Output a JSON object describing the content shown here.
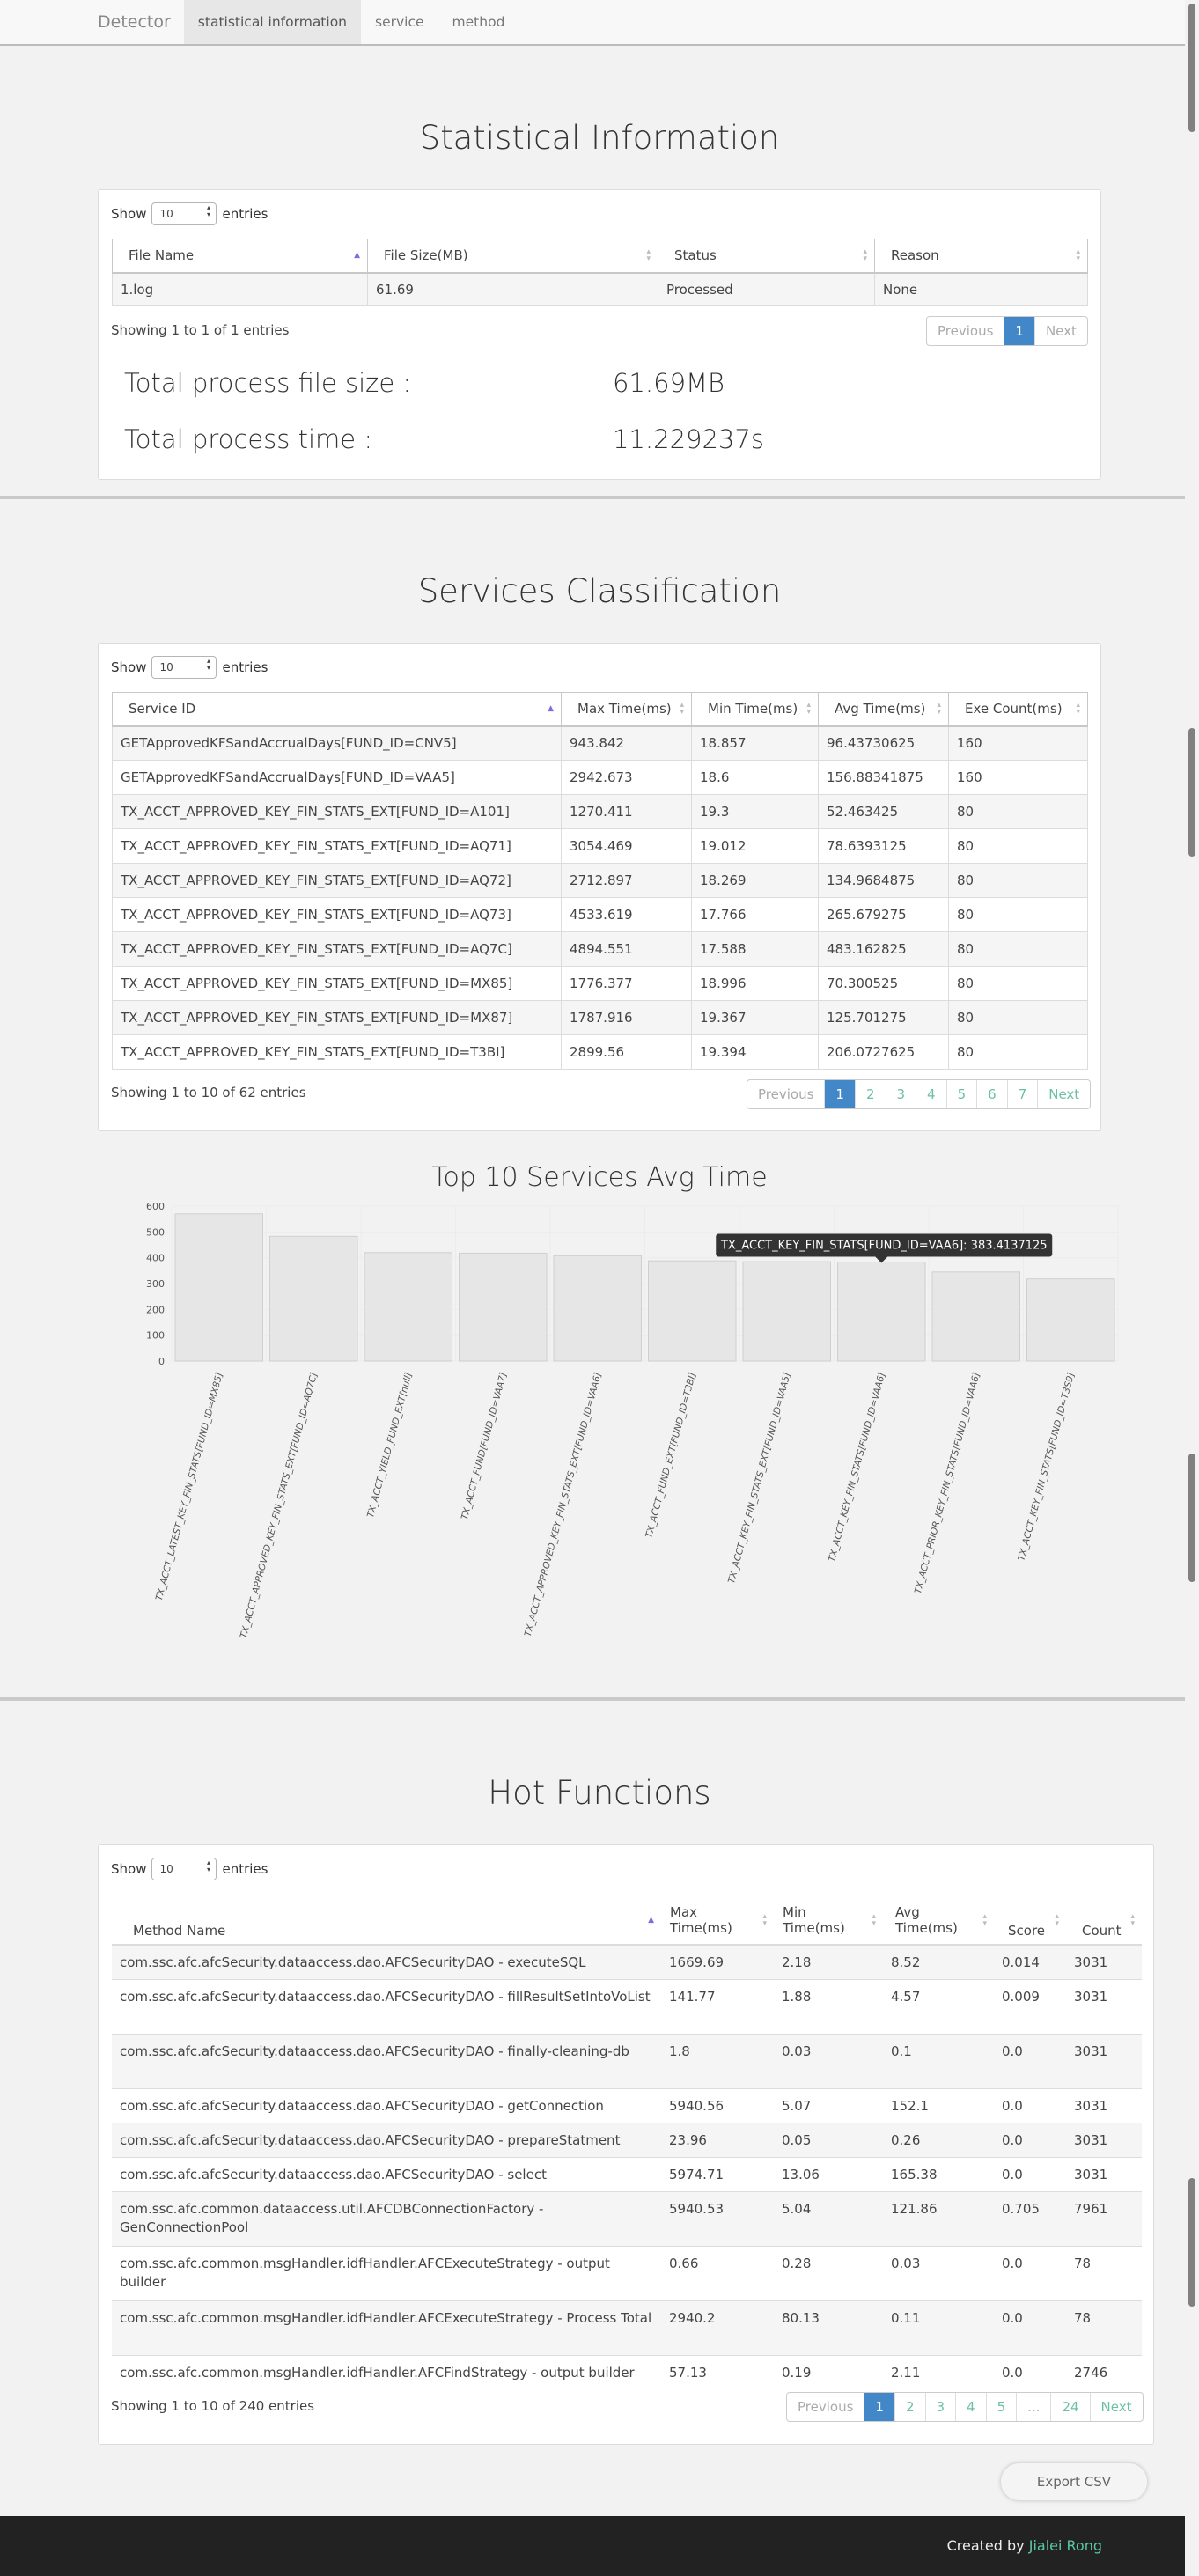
{
  "nav": {
    "brand": "Detector",
    "items": [
      "statistical information",
      "service",
      "method"
    ],
    "active_index": 0
  },
  "stats": {
    "title": "Statistical Information",
    "show": "Show",
    "entries_word": "entries",
    "page_length": "10",
    "columns": [
      "File Name",
      "File Size(MB)",
      "Status",
      "Reason"
    ],
    "rows": [
      [
        "1.log",
        "61.69",
        "Processed",
        "None"
      ]
    ],
    "info": "Showing 1 to 1 of 1 entries",
    "pager": [
      "Previous",
      "1",
      "Next"
    ],
    "total_size_label": "Total process file size :",
    "total_size_value": "61.69MB",
    "total_time_label": "Total process time :",
    "total_time_value": "11.229237s"
  },
  "services": {
    "title": "Services Classification",
    "show": "Show",
    "entries_word": "entries",
    "page_length": "10",
    "columns": [
      "Service ID",
      "Max Time(ms)",
      "Min Time(ms)",
      "Avg Time(ms)",
      "Exe Count(ms)"
    ],
    "rows": [
      [
        "GETApprovedKFSandAccrualDays[FUND_ID=CNV5]",
        "943.842",
        "18.857",
        "96.43730625",
        "160"
      ],
      [
        "GETApprovedKFSandAccrualDays[FUND_ID=VAA5]",
        "2942.673",
        "18.6",
        "156.88341875",
        "160"
      ],
      [
        "TX_ACCT_APPROVED_KEY_FIN_STATS_EXT[FUND_ID=A101]",
        "1270.411",
        "19.3",
        "52.463425",
        "80"
      ],
      [
        "TX_ACCT_APPROVED_KEY_FIN_STATS_EXT[FUND_ID=AQ71]",
        "3054.469",
        "19.012",
        "78.6393125",
        "80"
      ],
      [
        "TX_ACCT_APPROVED_KEY_FIN_STATS_EXT[FUND_ID=AQ72]",
        "2712.897",
        "18.269",
        "134.9684875",
        "80"
      ],
      [
        "TX_ACCT_APPROVED_KEY_FIN_STATS_EXT[FUND_ID=AQ73]",
        "4533.619",
        "17.766",
        "265.679275",
        "80"
      ],
      [
        "TX_ACCT_APPROVED_KEY_FIN_STATS_EXT[FUND_ID=AQ7C]",
        "4894.551",
        "17.588",
        "483.162825",
        "80"
      ],
      [
        "TX_ACCT_APPROVED_KEY_FIN_STATS_EXT[FUND_ID=MX85]",
        "1776.377",
        "18.996",
        "70.300525",
        "80"
      ],
      [
        "TX_ACCT_APPROVED_KEY_FIN_STATS_EXT[FUND_ID=MX87]",
        "1787.916",
        "19.367",
        "125.701275",
        "80"
      ],
      [
        "TX_ACCT_APPROVED_KEY_FIN_STATS_EXT[FUND_ID=T3BI]",
        "2899.56",
        "19.394",
        "206.0727625",
        "80"
      ]
    ],
    "info": "Showing 1 to 10 of 62 entries",
    "pager": [
      "Previous",
      "1",
      "2",
      "3",
      "4",
      "5",
      "6",
      "7",
      "Next"
    ]
  },
  "chart": {
    "tooltip": "TX_ACCT_KEY_FIN_STATS[FUND_ID=VAA6]: 383.4137125",
    "colors": {
      "bar": "#e6e6e6",
      "bar_stroke": "#cfcfcf",
      "grid": "#ececec",
      "tooltip_bg": "#333333"
    }
  },
  "chart_data": {
    "type": "bar",
    "title": "Top 10 Services Avg Time",
    "categories": [
      "TX_ACCT_LATEST_KEY_FIN_STATS[FUND_ID=MX85]",
      "TX_ACCT_APPROVED_KEY_FIN_STATS_EXT[FUND_ID=AQ7C]",
      "TX_ACCT_YIELD_FUND_EXT[null]",
      "TX_ACCT_FUND[FUND_ID=VAA7]",
      "TX_ACCT_APPROVED_KEY_FIN_STATS_EXT[FUND_ID=VAA6]",
      "TX_ACCT_FUND_EXT[FUND_ID=T3BI]",
      "TX_ACCT_KEY_FIN_STATS_EXT[FUND_ID=VAA5]",
      "TX_ACCT_KEY_FIN_STATS[FUND_ID=VAA6]",
      "TX_ACCT_PRIOR_KEY_FIN_STATS[FUND_ID=VAA6]",
      "TX_ACCT_KEY_FIN_STATS[FUND_ID=T3S9]"
    ],
    "values": [
      570,
      483,
      420,
      418,
      408,
      388,
      385,
      383.4137125,
      345,
      318
    ],
    "ylim": [
      0,
      600
    ],
    "yticks": [
      0,
      100,
      200,
      300,
      400,
      500,
      600
    ],
    "grid": true,
    "xlabel": "",
    "ylabel": ""
  },
  "hot": {
    "title": "Hot Functions",
    "show": "Show",
    "entries_word": "entries",
    "page_length": "10",
    "columns": [
      "Method Name",
      "Max Time(ms)",
      "Min Time(ms)",
      "Avg Time(ms)",
      "Score",
      "Count"
    ],
    "rows": [
      [
        "com.ssc.afc.afcSecurity.dataaccess.dao.AFCSecurityDAO - executeSQL",
        "1669.69",
        "2.18",
        "8.52",
        "0.014",
        "3031"
      ],
      [
        "com.ssc.afc.afcSecurity.dataaccess.dao.AFCSecurityDAO - fillResultSetIntoVoList",
        "141.77",
        "1.88",
        "4.57",
        "0.009",
        "3031"
      ],
      [
        "com.ssc.afc.afcSecurity.dataaccess.dao.AFCSecurityDAO - finally-cleaning-db",
        "1.8",
        "0.03",
        "0.1",
        "0.0",
        "3031"
      ],
      [
        "com.ssc.afc.afcSecurity.dataaccess.dao.AFCSecurityDAO - getConnection",
        "5940.56",
        "5.07",
        "152.1",
        "0.0",
        "3031"
      ],
      [
        "com.ssc.afc.afcSecurity.dataaccess.dao.AFCSecurityDAO - prepareStatment",
        "23.96",
        "0.05",
        "0.26",
        "0.0",
        "3031"
      ],
      [
        "com.ssc.afc.afcSecurity.dataaccess.dao.AFCSecurityDAO - select",
        "5974.71",
        "13.06",
        "165.38",
        "0.0",
        "3031"
      ],
      [
        "com.ssc.afc.common.dataaccess.util.AFCDBConnectionFactory - GenConnectionPool",
        "5940.53",
        "5.04",
        "121.86",
        "0.705",
        "7961"
      ],
      [
        "com.ssc.afc.common.msgHandler.idfHandler.AFCExecuteStrategy - output builder",
        "0.66",
        "0.28",
        "0.03",
        "0.0",
        "78"
      ],
      [
        "com.ssc.afc.common.msgHandler.idfHandler.AFCExecuteStrategy - Process Total",
        "2940.2",
        "80.13",
        "0.11",
        "0.0",
        "78"
      ],
      [
        "com.ssc.afc.common.msgHandler.idfHandler.AFCFindStrategy - output builder",
        "57.13",
        "0.19",
        "2.11",
        "0.0",
        "2746"
      ]
    ],
    "info": "Showing 1 to 10 of 240 entries",
    "pager": [
      "Previous",
      "1",
      "2",
      "3",
      "4",
      "5",
      "...",
      "24",
      "Next"
    ]
  },
  "export_label": "Export CSV",
  "footer": {
    "prefix": "Created by",
    "author": "Jialei Rong"
  }
}
